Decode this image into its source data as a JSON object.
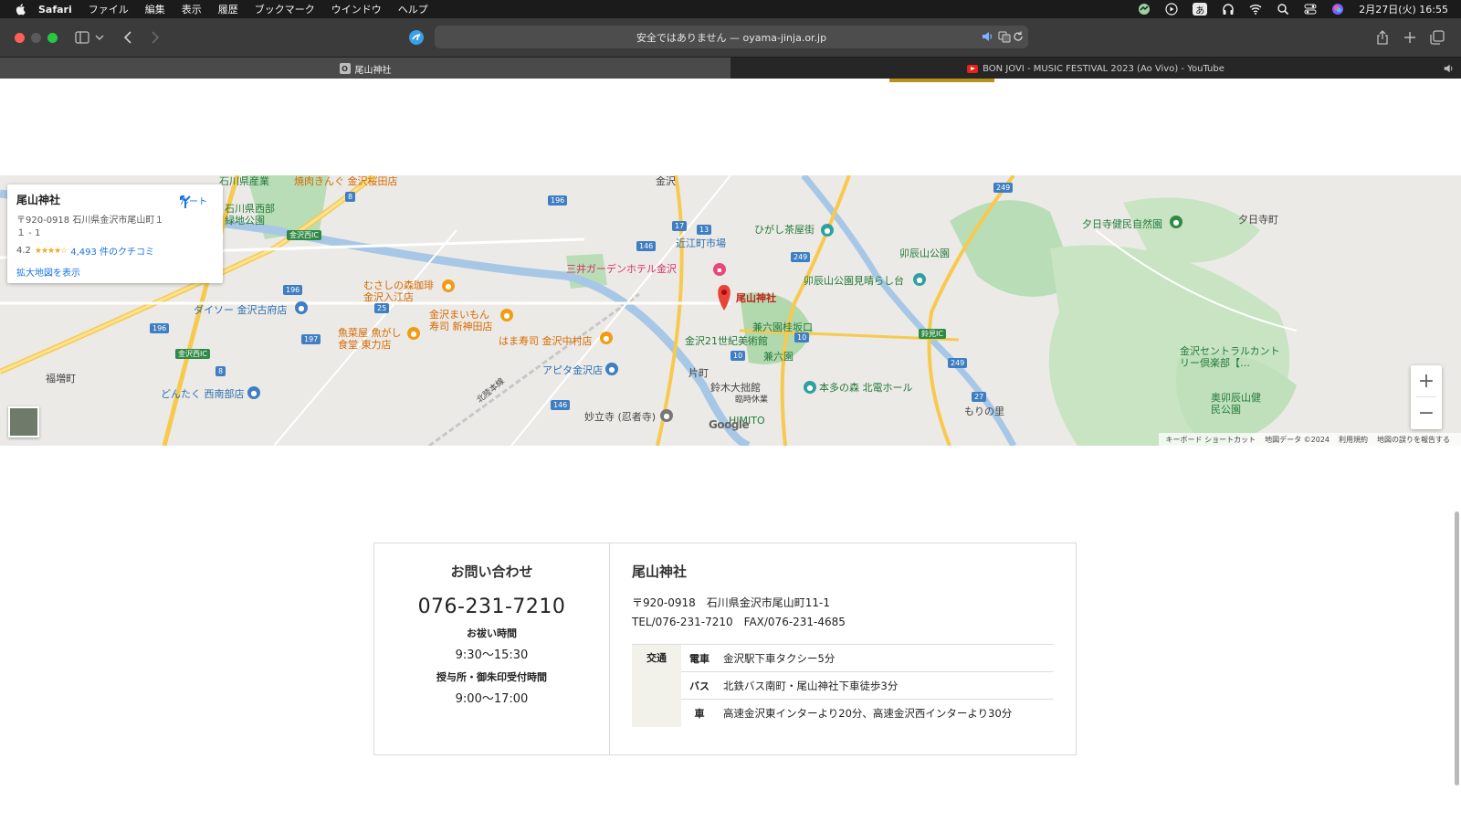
{
  "menubar": {
    "app": "Safari",
    "items": [
      "ファイル",
      "編集",
      "表示",
      "履歴",
      "ブックマーク",
      "ウインドウ",
      "ヘルプ"
    ],
    "ime": "あ",
    "clock": "2月27日(火) 16:55"
  },
  "toolbar": {
    "url": "安全ではありません — oyama-jinja.or.jp"
  },
  "tabs": [
    {
      "favicon": "O",
      "title": "尾山神社"
    },
    {
      "title": "BON JOVI - MUSIC FESTIVAL 2023 (Ao Vivo) - YouTube"
    }
  ],
  "map": {
    "card": {
      "title": "尾山神社",
      "address": "〒920-0918 石川県金沢市尾山町１１ - 1",
      "rating": "4.2",
      "stars": "★★★★☆",
      "reviews": "4,493 件のクチコミ",
      "route": "ルート",
      "large_map": "拡大地図を表示"
    },
    "labels": {
      "oyama": "尾山神社",
      "hotel": "三井ガーデンホテル金沢",
      "omicho": "近江町市場",
      "higashi": "ひがし茶屋街",
      "utatsu_park": "卯辰山公園",
      "utatsu_view": "卯辰山公園見晴らし台",
      "yuhi": "夕日寺健民自然園",
      "yuhi2": "夕日寺町",
      "kenrokuen_slope": "兼六園桂坂口",
      "kenrokuen": "兼六園",
      "museum21": "金沢21世紀美術館",
      "suzuki": "鈴木大拙館",
      "suzuki_closed": "臨時休業",
      "honda": "本多の森 北電ホール",
      "himito": "HIMITO",
      "myoryuji": "妙立寺 (忍者寺)",
      "apita": "アピタ金沢店",
      "hama": "はま寿司 金沢中村店",
      "maimon": "金沢まいもん寿司 新神田店",
      "musashi": "むさしの森珈琲金沢入江店",
      "daiso": "ダイソー 金沢古府店",
      "uoyasan": "魚菜屋 魚がし食堂 東力店",
      "dontaku": "どんたく 西南部店",
      "yakiniku": "焼肉きんぐ 金沢桜田店",
      "ishikawa_park": "石川県西部緑地公園",
      "ishikawa_sangyo": "石川県産業",
      "country": "金沢セントラルカントリー倶楽部【…",
      "okuutatsu": "奥卯辰山健民公園",
      "moriyama": "もりの里",
      "fukumasu": "福増町",
      "katamachi": "片町",
      "kanazawa_nishi_ic": "金沢西IC",
      "kanazawa_nishi_ic2": "金沢西IC",
      "kanazawa_station": "金沢",
      "hokurikusen": "北陸本線",
      "suzumi_ic": "鈴見IC",
      "google": "Google"
    },
    "footer": [
      "キーボード ショートカット",
      "地図データ ©2024",
      "利用規約",
      "地図の誤りを報告する"
    ],
    "zoom_in": "+",
    "zoom_out": "−"
  },
  "contact": {
    "heading": "お問い合わせ",
    "phone": "076-231-7210",
    "hours_label": "お祓い時間",
    "hours": "9:30〜15:30",
    "office_label": "授与所・御朱印受付時間",
    "office_hours": "9:00〜17:00",
    "name": "尾山神社",
    "address": "〒920-0918　石川県金沢市尾山町11-1",
    "tel_fax": "TEL/076-231-7210　FAX/076-231-4685",
    "access_label": "交通",
    "access": [
      {
        "mode": "電車",
        "text": "金沢駅下車タクシー5分"
      },
      {
        "mode": "バス",
        "text": "北鉄バス南町・尾山神社下車徒歩3分"
      },
      {
        "mode": "車",
        "text": "高速金沢東インターより20分、高速金沢西インターより30分"
      }
    ]
  }
}
